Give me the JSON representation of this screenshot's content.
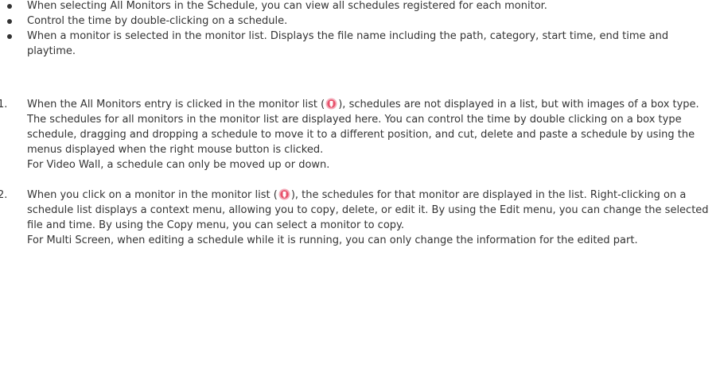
{
  "bullets": [
    "When selecting All Monitors in the Schedule, you can view all schedules registered for each monitor.",
    "Control the time by double-clicking on a schedule.",
    "When a monitor is selected in the monitor list. Displays the file name including the path, category, start time, end time and playtime."
  ],
  "steps": [
    {
      "number": "1.",
      "text_before": "When the All Monitors entry is clicked in the monitor list (",
      "text_after": "), schedules are not displayed in a list, but with images of a box type. The schedules for all monitors in the monitor list are displayed here. You can control the time by double clicking on a box type schedule, dragging and dropping a schedule to move it to a different position, and cut, delete and paste a schedule by using the menus displayed when the right mouse button is clicked.",
      "note": "For Video Wall, a schedule can only be moved up or down."
    },
    {
      "number": "2.",
      "text_before": "When you click on a monitor in the monitor list (",
      "text_after": "), the schedules for that monitor are displayed in the list. Right-clicking on a schedule list displays a context menu, allowing you to copy, delete, or edit it. By using the Edit menu, you can change the selected file and time. By using the Copy menu, you can select a monitor to copy.",
      "note": "For Multi Screen, when editing a schedule while it is running, you can only change the information for the edited part."
    }
  ],
  "icons": {
    "callout_marker": "callout-marker-icon",
    "callout_color": "#e8506a"
  }
}
